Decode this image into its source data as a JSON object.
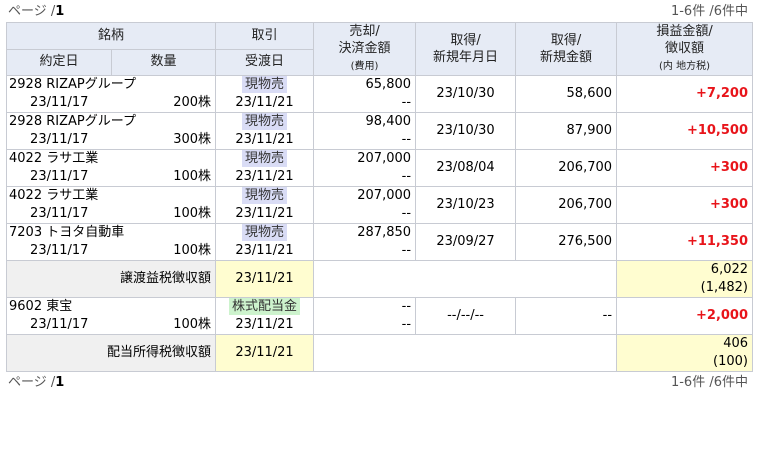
{
  "pager": {
    "page_prefix": "ページ /",
    "page_num": "1",
    "count": "1-6件 /6件中"
  },
  "headers": {
    "meigara": "銘柄",
    "torihiki": "取引",
    "baikyaku_l1": "売却/",
    "baikyaku_l2": "決済金額",
    "baikyaku_sub": "(費用)",
    "shutoku_l1": "取得/",
    "shutoku_l2": "新規年月日",
    "shutoku_amt_l1": "取得/",
    "shutoku_amt_l2": "新規金額",
    "pl_l1": "損益金額/",
    "pl_l2": "徴収額",
    "pl_sub": "(内 地方税)",
    "yakujo": "約定日",
    "suryo": "数量",
    "ukewatashi": "受渡日"
  },
  "trades": [
    {
      "name": "2928 RIZAPグループ",
      "trade_type": "現物売",
      "proceeds": "65,800",
      "fee": "--",
      "acq_date": "23/10/30",
      "acq_amount": "58,600",
      "profit": "+7,200",
      "exec_date": "23/11/17",
      "qty": "200株",
      "settle_date": "23/11/21"
    },
    {
      "name": "2928 RIZAPグループ",
      "trade_type": "現物売",
      "proceeds": "98,400",
      "fee": "--",
      "acq_date": "23/10/30",
      "acq_amount": "87,900",
      "profit": "+10,500",
      "exec_date": "23/11/17",
      "qty": "300株",
      "settle_date": "23/11/21"
    },
    {
      "name": "4022 ラサ工業",
      "trade_type": "現物売",
      "proceeds": "207,000",
      "fee": "--",
      "acq_date": "23/08/04",
      "acq_amount": "206,700",
      "profit": "+300",
      "exec_date": "23/11/17",
      "qty": "100株",
      "settle_date": "23/11/21"
    },
    {
      "name": "4022 ラサ工業",
      "trade_type": "現物売",
      "proceeds": "207,000",
      "fee": "--",
      "acq_date": "23/10/23",
      "acq_amount": "206,700",
      "profit": "+300",
      "exec_date": "23/11/17",
      "qty": "100株",
      "settle_date": "23/11/21"
    },
    {
      "name": "7203 トヨタ自動車",
      "trade_type": "現物売",
      "proceeds": "287,850",
      "fee": "--",
      "acq_date": "23/09/27",
      "acq_amount": "276,500",
      "profit": "+11,350",
      "exec_date": "23/11/17",
      "qty": "100株",
      "settle_date": "23/11/21"
    }
  ],
  "summary_transfer": {
    "label": "譲渡益税徴収額",
    "date": "23/11/21",
    "amount": "6,022",
    "local": "(1,482)"
  },
  "dividend": {
    "name": "9602 東宝",
    "trade_type": "株式配当金",
    "proceeds": "--",
    "fee": "--",
    "acq_date": "--/--/--",
    "acq_amount": "--",
    "profit": "+2,000",
    "exec_date": "23/11/17",
    "qty": "100株",
    "settle_date": "23/11/21"
  },
  "summary_dividend": {
    "label": "配当所得税徴収額",
    "date": "23/11/21",
    "amount": "406",
    "local": "(100)"
  }
}
